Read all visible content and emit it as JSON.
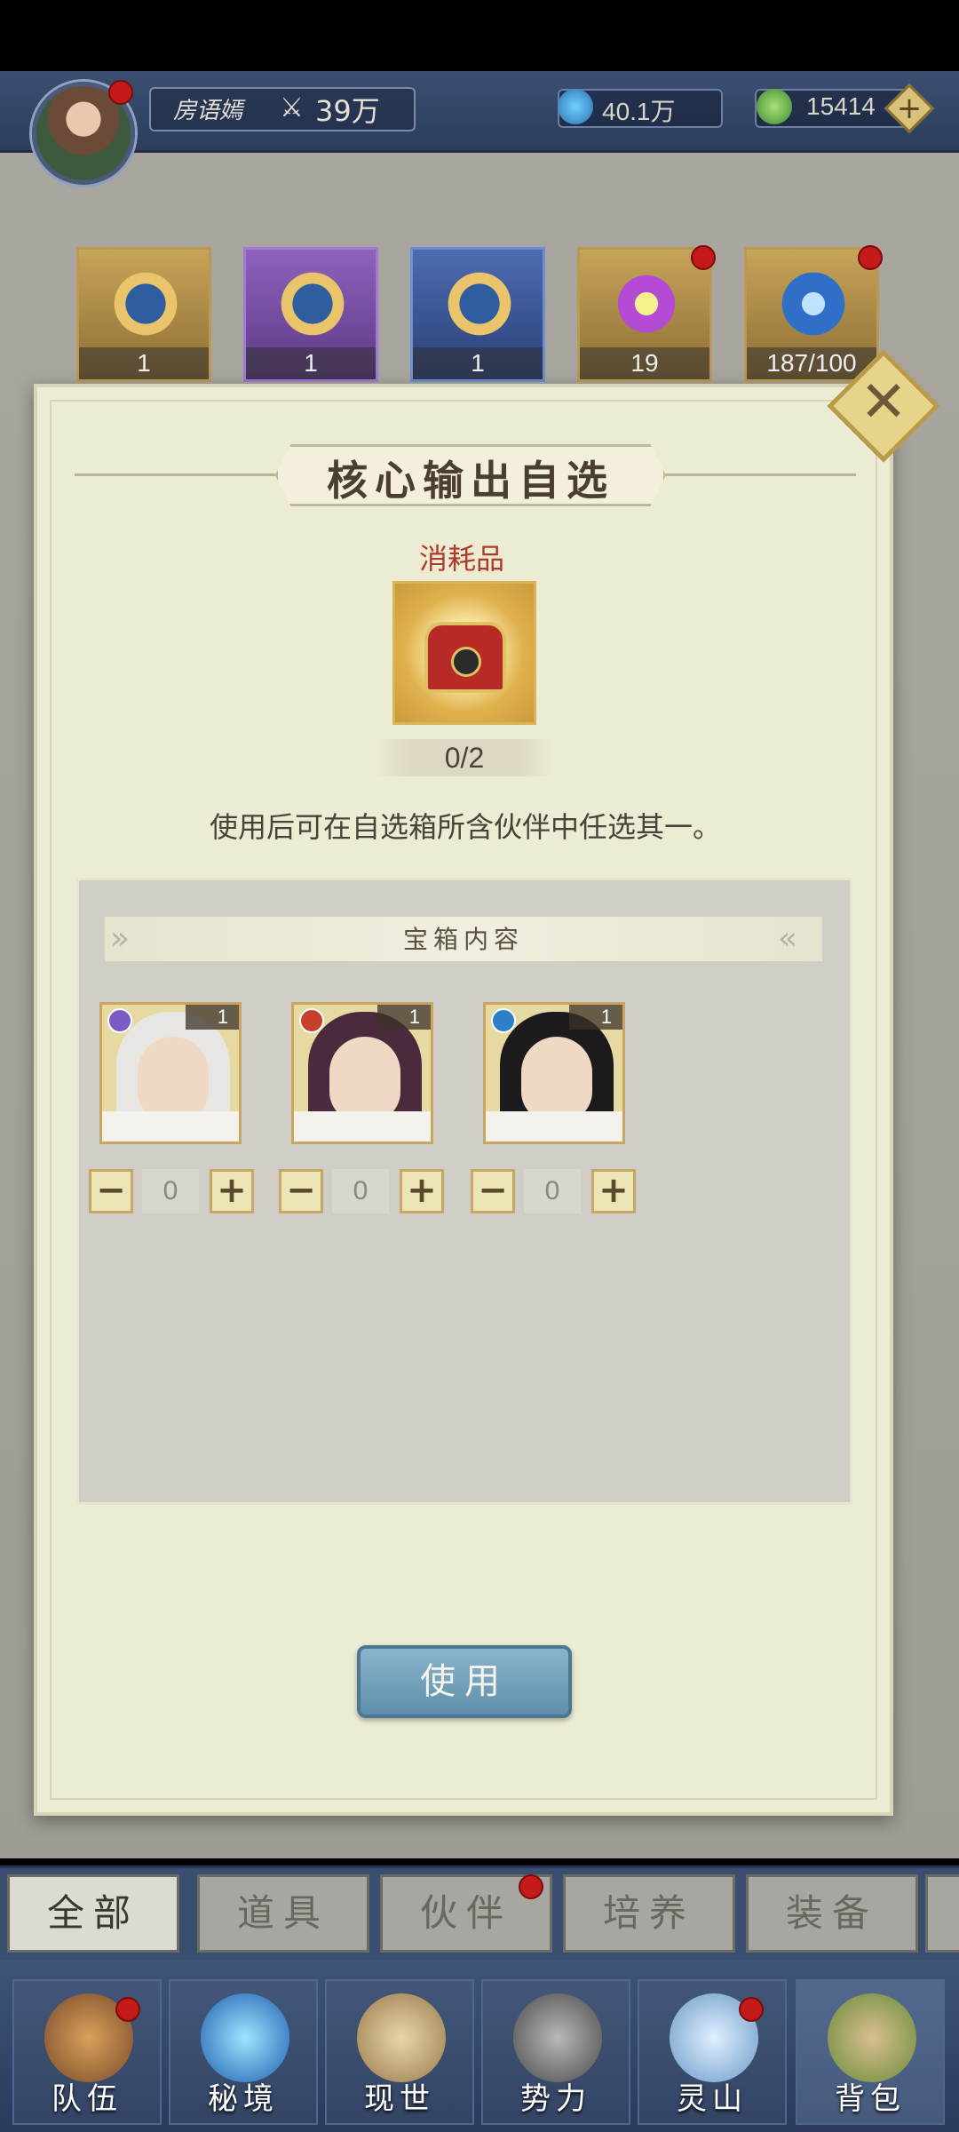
{
  "header": {
    "player_name": "房语嫣",
    "power": "39万",
    "currency_spirit": "40.1万",
    "currency_jade": "15414"
  },
  "inventory_strip": [
    {
      "count": "1",
      "icon": "scroll-icon",
      "frame": "#b8924a"
    },
    {
      "count": "1",
      "icon": "scroll-icon",
      "frame": "#7a4ea8"
    },
    {
      "count": "1",
      "icon": "scroll-icon",
      "frame": "#3e5c9c"
    },
    {
      "count": "19",
      "icon": "crystal-icon",
      "frame": "#b8924a"
    },
    {
      "count": "187/100",
      "icon": "dragon-fragment-icon",
      "frame": "#b8924a"
    }
  ],
  "dialog": {
    "title": "核心输出自选",
    "category": "消耗品",
    "count": "0/2",
    "description": "使用后可在自选箱所含伙伴中任选其一。",
    "contents_title": "宝箱内容",
    "heroes": [
      {
        "level": "1",
        "element": "wind-element-icon",
        "element_color": "#7b5cc4",
        "hair": "#e8e6e2",
        "qty": "0",
        "minus": "−",
        "plus": "+"
      },
      {
        "level": "1",
        "element": "fire-element-icon",
        "element_color": "#c8402c",
        "hair": "#4a2a3c",
        "qty": "0",
        "minus": "−",
        "plus": "+"
      },
      {
        "level": "1",
        "element": "water-element-icon",
        "element_color": "#2f7fc8",
        "hair": "#1c1a1c",
        "qty": "0",
        "minus": "−",
        "plus": "+"
      }
    ],
    "use_button": "使用"
  },
  "tabs": [
    "全部",
    "道具",
    "伙伴",
    "培养",
    "装备"
  ],
  "nav": [
    "队伍",
    "秘境",
    "现世",
    "势力",
    "灵山",
    "背包"
  ],
  "colors": {
    "accent_red": "#c41a1a",
    "use_button": "#6f9fba",
    "panel": "#ecebd4"
  }
}
